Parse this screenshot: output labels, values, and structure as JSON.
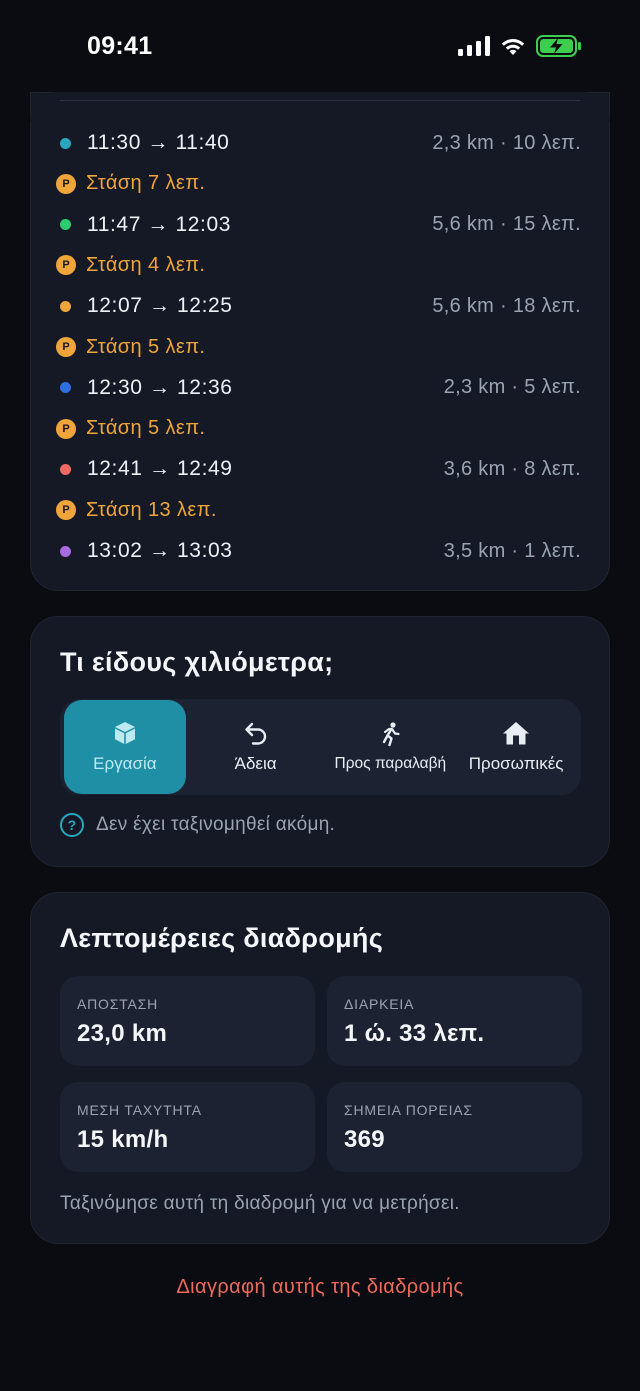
{
  "status": {
    "time": "09:41"
  },
  "trips": [
    {
      "type": "leg",
      "color": "#2aa7bf",
      "time": "11:30 → 11:40",
      "meta": "2,3 km · 10 λεπ."
    },
    {
      "type": "stop",
      "badge": "P",
      "text": "Στάση 7 λεπ."
    },
    {
      "type": "leg",
      "color": "#2ecc71",
      "time": "11:47 → 12:03",
      "meta": "5,6 km · 15 λεπ."
    },
    {
      "type": "stop",
      "badge": "P",
      "text": "Στάση 4 λεπ."
    },
    {
      "type": "leg",
      "color": "#f0a53a",
      "time": "12:07 → 12:25",
      "meta": "5,6 km · 18 λεπ."
    },
    {
      "type": "stop",
      "badge": "P",
      "text": "Στάση 5 λεπ."
    },
    {
      "type": "leg",
      "color": "#2f6fe0",
      "time": "12:30 → 12:36",
      "meta": "2,3 km · 5 λεπ."
    },
    {
      "type": "stop",
      "badge": "P",
      "text": "Στάση 5 λεπ."
    },
    {
      "type": "leg",
      "color": "#f06a63",
      "time": "12:41 → 12:49",
      "meta": "3,6 km · 8 λεπ."
    },
    {
      "type": "stop",
      "badge": "P",
      "text": "Στάση 13 λεπ."
    },
    {
      "type": "leg",
      "color": "#a86ce0",
      "time": "13:02 → 13:03",
      "meta": "3,5 km · 1 λεπ."
    }
  ],
  "kind": {
    "title": "Τι είδους χιλιόμετρα;",
    "options": [
      {
        "label": "Εργασία",
        "icon": "box-icon",
        "selected": true
      },
      {
        "label": "Άδεια",
        "icon": "undo-arrow-icon",
        "selected": false
      },
      {
        "label": "Προς παραλαβή",
        "icon": "runner-icon",
        "selected": false
      },
      {
        "label": "Προσωπικές",
        "icon": "house-icon",
        "selected": false
      }
    ],
    "hint": "Δεν έχει ταξινομηθεί ακόμη.",
    "hint_icon": "?"
  },
  "details": {
    "title": "Λεπτομέρειες διαδρομής",
    "distance_label": "ΑΠΟΣΤΑΣΗ",
    "distance_value": "23,0 km",
    "duration_label": "ΔΙΑΡΚΕΙΑ",
    "duration_value": "1 ώ. 33 λεπ.",
    "speed_label": "ΜΕΣΗ ΤΑΧΥΤΗΤΑ",
    "speed_value": "15 km/h",
    "points_label": "ΣΗΜΕΙΑ ΠΟΡΕΙΑΣ",
    "points_value": "369",
    "note": "Ταξινόμησε αυτή τη διαδρομή για να μετρήσει."
  },
  "delete_label": "Διαγραφή αυτής της διαδρομής",
  "colors": {
    "accent": "#1f8fa6",
    "stop": "#f0a53a",
    "danger": "#ef6a5a"
  }
}
